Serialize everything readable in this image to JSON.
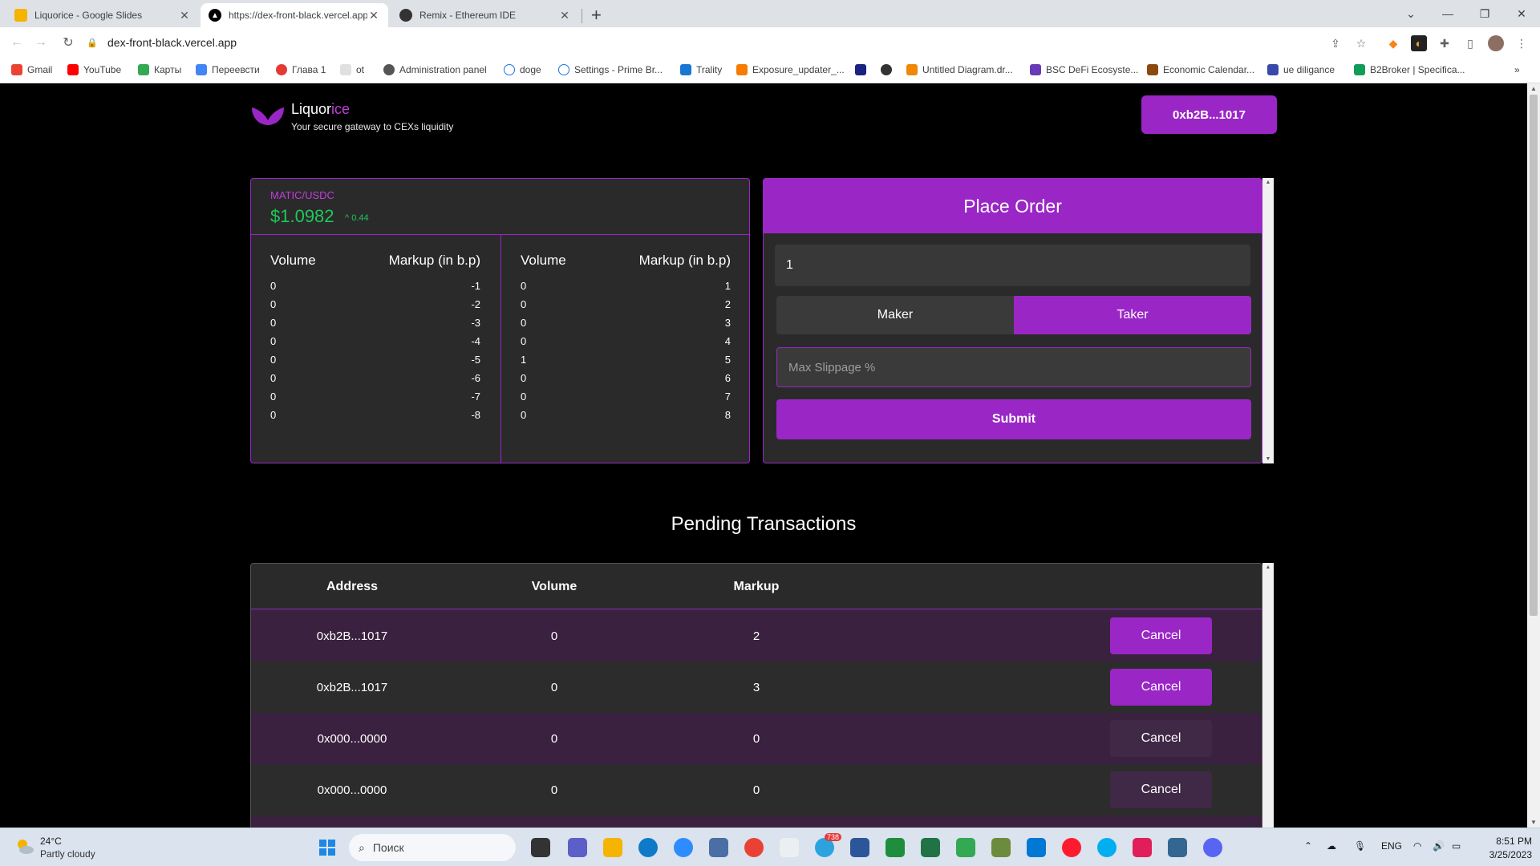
{
  "browser": {
    "tabs": [
      {
        "title": "Liquorice - Google Slides",
        "favicon": "slides-icon",
        "color": "#f4b400"
      },
      {
        "title": "https://dex-front-black.vercel.app",
        "favicon": "vercel-icon",
        "color": "#000000"
      },
      {
        "title": "Remix - Ethereum IDE",
        "favicon": "remix-icon",
        "color": "#222222"
      }
    ],
    "url": "dex-front-black.vercel.app",
    "bookmarks": [
      {
        "label": "Gmail",
        "color": "#ea4335"
      },
      {
        "label": "YouTube",
        "color": "#ff0000"
      },
      {
        "label": "Карты",
        "color": "#34a853"
      },
      {
        "label": "Переевсти",
        "color": "#4285f4"
      },
      {
        "label": "Глава 1",
        "color": "#e53935"
      },
      {
        "label": "ot",
        "color": "#9e9e9e"
      },
      {
        "label": "Administration panel",
        "color": "#555555"
      },
      {
        "label": "doge",
        "color": "#1a73e8"
      },
      {
        "label": "Settings - Prime Br...",
        "color": "#1a73e8"
      },
      {
        "label": "Trality",
        "color": "#1976d2"
      },
      {
        "label": "Exposure_updater_...",
        "color": "#f57c00"
      },
      {
        "label": "",
        "color": "#1a237e"
      },
      {
        "label": "",
        "color": "#333333"
      },
      {
        "label": "Untitled Diagram.dr...",
        "color": "#f08705"
      },
      {
        "label": "BSC DeFi Ecosyste...",
        "color": "#673ab7"
      },
      {
        "label": "Economic Calendar...",
        "color": "#8d4a10"
      },
      {
        "label": "ue diligance",
        "color": "#3949ab"
      },
      {
        "label": "B2Broker | Specifica...",
        "color": "#0f9d58"
      }
    ]
  },
  "header": {
    "brand_main": "Liquor",
    "brand_accent": "ice",
    "tagline": "Your secure gateway to CEXs liquidity",
    "wallet": "0xb2B...1017"
  },
  "orderbook": {
    "pair": "MATIC/USDC",
    "price": "$1.0982",
    "change": "0.44",
    "col_volume": "Volume",
    "col_markup": "Markup (in b.p)",
    "bids": [
      {
        "volume": "0",
        "markup": "-1"
      },
      {
        "volume": "0",
        "markup": "-2"
      },
      {
        "volume": "0",
        "markup": "-3"
      },
      {
        "volume": "0",
        "markup": "-4"
      },
      {
        "volume": "0",
        "markup": "-5"
      },
      {
        "volume": "0",
        "markup": "-6"
      },
      {
        "volume": "0",
        "markup": "-7"
      },
      {
        "volume": "0",
        "markup": "-8"
      }
    ],
    "asks": [
      {
        "volume": "0",
        "markup": "1"
      },
      {
        "volume": "0",
        "markup": "2"
      },
      {
        "volume": "0",
        "markup": "3"
      },
      {
        "volume": "0",
        "markup": "4"
      },
      {
        "volume": "1",
        "markup": "5"
      },
      {
        "volume": "0",
        "markup": "6"
      },
      {
        "volume": "0",
        "markup": "7"
      },
      {
        "volume": "0",
        "markup": "8"
      }
    ]
  },
  "place_order": {
    "title": "Place Order",
    "amount": "1",
    "maker": "Maker",
    "taker": "Taker",
    "slippage_placeholder": "Max Slippage %",
    "submit": "Submit"
  },
  "pending": {
    "title": "Pending Transactions",
    "headers": {
      "address": "Address",
      "volume": "Volume",
      "markup": "Markup"
    },
    "rows": [
      {
        "address": "0xb2B...1017",
        "volume": "0",
        "markup": "2",
        "action": "Cancel",
        "active": true
      },
      {
        "address": "0xb2B...1017",
        "volume": "0",
        "markup": "3",
        "action": "Cancel",
        "active": true
      },
      {
        "address": "0x000...0000",
        "volume": "0",
        "markup": "0",
        "action": "Cancel",
        "active": false
      },
      {
        "address": "0x000...0000",
        "volume": "0",
        "markup": "0",
        "action": "Cancel",
        "active": false
      }
    ]
  },
  "taskbar": {
    "temp": "24°C",
    "weather": "Partly cloudy",
    "search": "Поиск",
    "lang": "ENG",
    "time": "8:51 PM",
    "date": "3/25/2023",
    "badge": "738"
  },
  "colors": {
    "accent": "#9a26c6",
    "positive": "#20c75b"
  }
}
